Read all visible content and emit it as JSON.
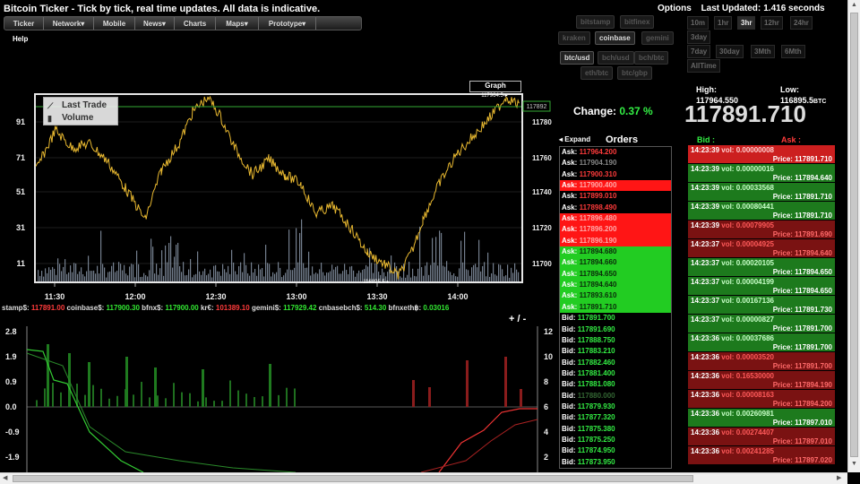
{
  "title": "Bitcoin Ticker - Tick by tick, real time updates. All data is indicative.",
  "nav": [
    "Ticker",
    "Network▾",
    "Mobile",
    "News▾",
    "Charts",
    "Maps▾",
    "Prototype▾"
  ],
  "help": "Help",
  "top": {
    "options": "Options",
    "last_updated_label": "Last Updated:",
    "last_updated_value": "1.416 seconds"
  },
  "exchanges": [
    "bitstamp",
    "bitfinex",
    "kraken",
    "coinbase",
    "gemini"
  ],
  "active_exchange": "coinbase",
  "pairs": [
    "btc/usd",
    "bch/usd",
    "bch/btc",
    "eth/btc",
    "btc/gbp"
  ],
  "active_pair": "btc/usd",
  "timeframes": [
    "10m",
    "1hr",
    "3hr",
    "12hr",
    "24hr",
    "3day",
    "7day",
    "30day",
    "3Mth",
    "6Mth",
    "AllTime"
  ],
  "active_timeframe": "3hr",
  "chart": {
    "graph_label": "Graph",
    "legend_trade": "Last Trade",
    "legend_volume": "Volume",
    "y_ticks": [
      "91",
      "71",
      "51",
      "31",
      "11"
    ],
    "right_ticks": [
      "11780",
      "11760",
      "11740",
      "11720",
      "11700"
    ],
    "x_ticks": [
      "11:30",
      "12:00",
      "12:30",
      "13:00",
      "13:30",
      "14:00"
    ],
    "current_price_tag": "117892",
    "high_marker": "117964.5",
    "low_marker": "116895.5"
  },
  "chart_data": {
    "type": "line",
    "x": [
      "11:30",
      "12:00",
      "12:30",
      "13:00",
      "13:30",
      "14:00"
    ],
    "series": [
      {
        "name": "Last Trade",
        "values": [
          117760,
          117730,
          117775,
          117735,
          117700,
          117760
        ]
      },
      {
        "name": "Volume",
        "values": [
          20,
          35,
          30,
          40,
          25,
          45
        ]
      }
    ],
    "ylim": [
      116950,
      117960
    ]
  },
  "tickers": [
    {
      "label": "stamp$:",
      "value": "117891.00",
      "color": "red"
    },
    {
      "label": "coinbase$:",
      "value": "117900.30",
      "color": "green"
    },
    {
      "label": "bfnx$:",
      "value": "117900.00",
      "color": "green"
    },
    {
      "label": "kr€:",
      "value": "101389.10",
      "color": "red"
    },
    {
      "label": "gemini$:",
      "value": "117929.42",
      "color": "green"
    },
    {
      "label": "cnbasebch$:",
      "value": "514.30",
      "color": "green"
    },
    {
      "label": "bfnxeth฿:",
      "value": "0.03016",
      "color": "green"
    }
  ],
  "plus_minus": "+ / -",
  "change": {
    "label": "Change:",
    "value": "0.37 %"
  },
  "high": {
    "label": "High:",
    "value": "117964.550"
  },
  "low": {
    "label": "Low:",
    "value": "116895.5",
    "suffix": "BTC"
  },
  "big_price": "117891.710",
  "orders": {
    "expand": "◂ Expand",
    "title": "Orders",
    "rows": [
      {
        "t": "Ask:",
        "v": "117964.200",
        "s": "ask-plain"
      },
      {
        "t": "Ask:",
        "v": "117904.190",
        "s": "ask-faded"
      },
      {
        "t": "Ask:",
        "v": "117900.310",
        "s": "ask-plain"
      },
      {
        "t": "Ask:",
        "v": "117900.400",
        "s": "ask-hl"
      },
      {
        "t": "Ask:",
        "v": "117899.010",
        "s": "ask-plain"
      },
      {
        "t": "Ask:",
        "v": "117898.490",
        "s": "ask-plain"
      },
      {
        "t": "Ask:",
        "v": "117896.480",
        "s": "ask-hl"
      },
      {
        "t": "Ask:",
        "v": "117896.200",
        "s": "ask-hl"
      },
      {
        "t": "Ask:",
        "v": "117896.190",
        "s": "ask-hl"
      },
      {
        "t": "Ask:",
        "v": "117894.680",
        "s": "ask-green"
      },
      {
        "t": "Ask:",
        "v": "117894.660",
        "s": "ask-green"
      },
      {
        "t": "Ask:",
        "v": "117894.650",
        "s": "ask-green"
      },
      {
        "t": "Ask:",
        "v": "117894.640",
        "s": "ask-green"
      },
      {
        "t": "Ask:",
        "v": "117893.610",
        "s": "ask-green"
      },
      {
        "t": "Ask:",
        "v": "117891.710",
        "s": "ask-green"
      },
      {
        "t": "Bid:",
        "v": "117891.700",
        "s": "bid-plain"
      },
      {
        "t": "Bid:",
        "v": "117891.690",
        "s": "bid-plain"
      },
      {
        "t": "Bid:",
        "v": "117888.750",
        "s": "bid-plain"
      },
      {
        "t": "Bid:",
        "v": "117883.210",
        "s": "bid-plain"
      },
      {
        "t": "Bid:",
        "v": "117882.460",
        "s": "bid-plain"
      },
      {
        "t": "Bid:",
        "v": "117881.400",
        "s": "bid-plain"
      },
      {
        "t": "Bid:",
        "v": "117881.080",
        "s": "bid-plain"
      },
      {
        "t": "Bid:",
        "v": "117880.000",
        "s": "bid-faded"
      },
      {
        "t": "Bid:",
        "v": "117879.930",
        "s": "bid-plain"
      },
      {
        "t": "Bid:",
        "v": "117877.320",
        "s": "bid-plain"
      },
      {
        "t": "Bid:",
        "v": "117875.380",
        "s": "bid-plain"
      },
      {
        "t": "Bid:",
        "v": "117875.250",
        "s": "bid-plain"
      },
      {
        "t": "Bid:",
        "v": "117874.950",
        "s": "bid-plain"
      },
      {
        "t": "Bid:",
        "v": "117873.950",
        "s": "bid-plain"
      }
    ]
  },
  "trades": {
    "bid_header": "Bid :",
    "ask_header": "Ask :",
    "rows": [
      {
        "time": "14:23:39",
        "vol": "vol: 0.00000008",
        "price": "Price: 117891.710",
        "k": "sell-bright"
      },
      {
        "time": "14:23:39",
        "vol": "vol: 0.00000016",
        "price": "Price: 117894.640",
        "k": "buy"
      },
      {
        "time": "14:23:39",
        "vol": "vol: 0.00033568",
        "price": "Price: 117891.710",
        "k": "buy"
      },
      {
        "time": "14:23:39",
        "vol": "vol: 0.00080441",
        "price": "Price: 117891.710",
        "k": "buy"
      },
      {
        "time": "14:23:39",
        "vol": "vol: 0.00079905",
        "price": "Price: 117891.690",
        "k": "sell"
      },
      {
        "time": "14:23:37",
        "vol": "vol: 0.00004925",
        "price": "Price: 117894.640",
        "k": "sell"
      },
      {
        "time": "14:23:37",
        "vol": "vol: 0.00020105",
        "price": "Price: 117894.650",
        "k": "buy"
      },
      {
        "time": "14:23:37",
        "vol": "vol: 0.00004199",
        "price": "Price: 117894.650",
        "k": "buy"
      },
      {
        "time": "14:23:37",
        "vol": "vol: 0.00167136",
        "price": "Price: 117891.730",
        "k": "buy"
      },
      {
        "time": "14:23:37",
        "vol": "vol: 0.00000827",
        "price": "Price: 117891.700",
        "k": "buy"
      },
      {
        "time": "14:23:36",
        "vol": "vol: 0.00037686",
        "price": "Price: 117891.700",
        "k": "buy"
      },
      {
        "time": "14:23:36",
        "vol": "vol: 0.00003520",
        "price": "Price: 117891.700",
        "k": "sell"
      },
      {
        "time": "14:23:36",
        "vol": "vol: 0.16530000",
        "price": "Price: 117894.190",
        "k": "sell"
      },
      {
        "time": "14:23:36",
        "vol": "vol: 0.00008163",
        "price": "Price: 117894.200",
        "k": "sell"
      },
      {
        "time": "14:23:36",
        "vol": "vol: 0.00260981",
        "price": "Price: 117897.010",
        "k": "buy"
      },
      {
        "time": "14:23:36",
        "vol": "vol: 0.00274407",
        "price": "Price: 117897.010",
        "k": "sell"
      },
      {
        "time": "14:23:36",
        "vol": "vol: 0.00241285",
        "price": "Price: 117897.020",
        "k": "sell"
      }
    ]
  },
  "lower_chart": {
    "left_ticks": [
      "2.8",
      "1.9",
      "0.9",
      "0.0",
      "-0.9",
      "-1.9"
    ],
    "right_ticks": [
      "12",
      "10",
      "8",
      "6",
      "4",
      "2"
    ]
  },
  "colors": {
    "up": "#33ee44",
    "down": "#ff3b3b",
    "price_line": "#e8b830",
    "volume": "#9aa8bc"
  }
}
